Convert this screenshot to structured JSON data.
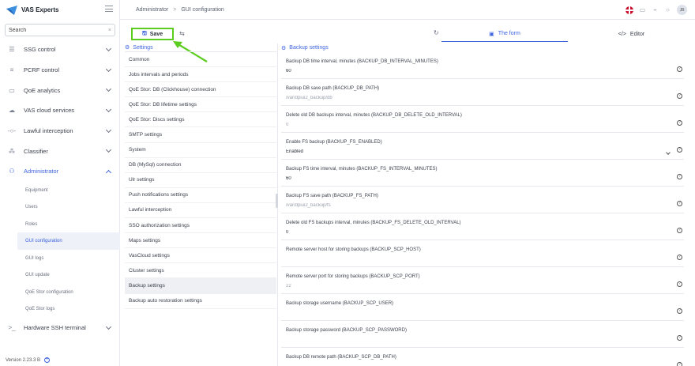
{
  "brand": {
    "name": "VAS Experts"
  },
  "search": {
    "placeholder": "Search"
  },
  "nav": {
    "items": [
      {
        "label": "SSG control",
        "icon": "list-icon"
      },
      {
        "label": "PCRF control",
        "icon": "sliders-icon"
      },
      {
        "label": "QoE analytics",
        "icon": "chart-icon"
      },
      {
        "label": "VAS cloud services",
        "icon": "cloud-icon"
      },
      {
        "label": "Lawful interception",
        "icon": "intercept-icon"
      },
      {
        "label": "Classifier",
        "icon": "tree-icon"
      },
      {
        "label": "Administrator",
        "icon": "users-icon"
      }
    ],
    "admin_sub": [
      "Equipment",
      "Users",
      "Roles",
      "GUI configuration",
      "GUI logs",
      "GUI update",
      "QoE Stor configuration",
      "QoE Stor logs"
    ],
    "terminal": {
      "label": "Hardware SSH terminal",
      "icon": "terminal-icon"
    }
  },
  "version": "Version 2.23.3 B",
  "breadcrumb": {
    "root": "Administrator",
    "sep": ">",
    "current": "GUI configuration"
  },
  "topbar": {
    "avatar": "JB"
  },
  "toolbar": {
    "save_label": "Save",
    "tab_form": "The form",
    "tab_editor": "Editor",
    "editor_icon": "</>"
  },
  "settings": {
    "title": "Settings",
    "items": [
      "Common",
      "Jobs intervals and periods",
      "QoE Stor: DB (Clickhouse) connection",
      "QoE Stor: DB lifetime settings",
      "QoE Stor: Discs settings",
      "SMTP settings",
      "System",
      "DB (MySql) connection",
      "Ulr settings",
      "Push notifications settings",
      "Lawful interception",
      "SSO authorization settings",
      "Maps settings",
      "VasCloud settings",
      "Cluster settings",
      "Backup settings",
      "Backup auto restoration settings"
    ],
    "selected": "Backup settings"
  },
  "form": {
    "title": "Backup settings",
    "fields": [
      {
        "label": "Backup DB time interval, minutes (BACKUP_DB_INTERVAL_MINUTES)",
        "value": "60",
        "muted": false
      },
      {
        "label": "Backup DB save path (BACKUP_DB_PATH)",
        "value": "/var/dpiui2_backup/db",
        "muted": true
      },
      {
        "label": "Delete old DB backups interval, minutes (BACKUP_DB_DELETE_OLD_INTERVAL)",
        "value": "0",
        "muted": true
      },
      {
        "label": "Enable FS backup (BACKUP_FS_ENABLED)",
        "value": "Enabled",
        "muted": false,
        "dropdown": true
      },
      {
        "label": "Backup FS time interval, minutes (BACKUP_FS_INTERVAL_MINUTES)",
        "value": "60",
        "muted": false
      },
      {
        "label": "Backup FS save path (BACKUP_FS_PATH)",
        "value": "/var/dpiui2_backup/fs",
        "muted": true
      },
      {
        "label": "Delete old FS backups interval, minutes (BACKUP_FS_DELETE_OLD_INTERVAL)",
        "value": "0",
        "muted": false
      },
      {
        "label": "Remote server host for storing backups (BACKUP_SCP_HOST)",
        "value": "",
        "muted": false
      },
      {
        "label": "Remote server port for storing backups (BACKUP_SCP_PORT)",
        "value": "22",
        "muted": true
      },
      {
        "label": "Backup storage username (BACKUP_SCP_USER)",
        "value": "",
        "muted": false
      },
      {
        "label": "Backup storage password (BACKUP_SCP_PASSWORD)",
        "value": "",
        "muted": false
      },
      {
        "label": "Backup DB remote path (BACKUP_SCP_DB_PATH)",
        "value": "",
        "muted": false
      }
    ]
  },
  "colors": {
    "accent": "#3d63dd",
    "highlight": "#5ccc1e"
  }
}
